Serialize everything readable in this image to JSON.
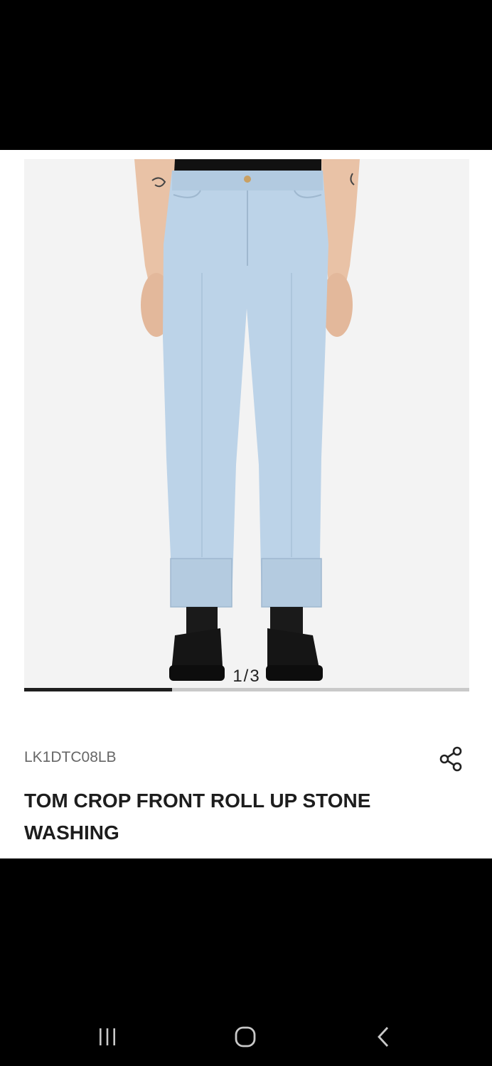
{
  "gallery": {
    "counter": "1/3",
    "current_index": 1,
    "total": 3,
    "progress_fraction": 0.333,
    "image_alt_icon": "product-photo-jeans"
  },
  "product": {
    "sku": "LK1DTC08LB",
    "title": "TOM CROP FRONT ROLL UP STONE WASHING",
    "share_icon": "share-icon"
  },
  "system_nav": {
    "recent_icon": "recent-apps-icon",
    "home_icon": "home-icon",
    "back_icon": "back-icon"
  },
  "colors": {
    "background": "#000000",
    "content_bg": "#ffffff",
    "image_bg": "#f3f3f3",
    "denim": "#bcd3e8",
    "progress_fill": "#1e1e1e",
    "progress_track": "#c9c9c9"
  }
}
